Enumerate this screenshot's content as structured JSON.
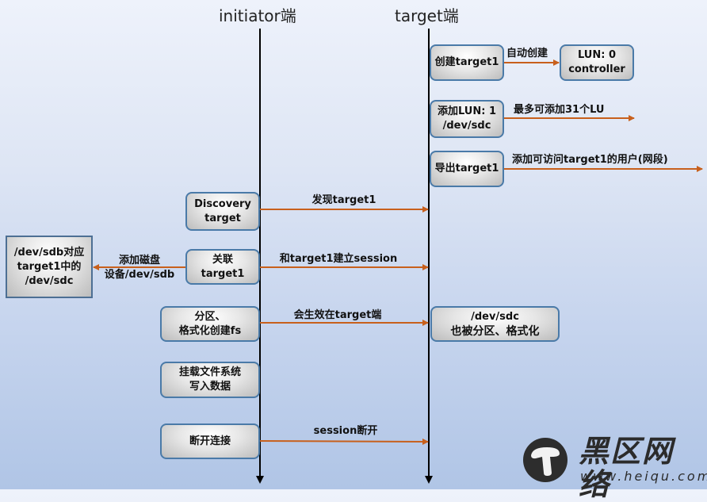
{
  "lanes": {
    "initiator": "initiator端",
    "target": "target端"
  },
  "colors": {
    "arrow": "#c8601c",
    "lifeline": "#000000",
    "box_border": "#4a7aa8"
  },
  "target_steps": [
    {
      "label_lines": [
        "创建target1"
      ],
      "arrow_label": "自动创建",
      "result_lines": [
        "LUN: 0",
        "controller"
      ]
    },
    {
      "label_lines": [
        "添加LUN: 1",
        "/dev/sdc"
      ],
      "arrow_label": "最多可添加31个LU"
    },
    {
      "label_lines": [
        "导出target1"
      ],
      "arrow_label": "添加可访问target1的用户(网段)"
    }
  ],
  "initiator_steps": [
    {
      "label_lines": [
        "Discovery",
        "target"
      ],
      "message": "发现target1"
    },
    {
      "label_lines": [
        "关联",
        "target1"
      ],
      "message": "和target1建立session",
      "side_label_lines": [
        "添加磁盘",
        "设备/dev/sdb"
      ],
      "side_box_lines": [
        "/dev/sdb对应",
        "target1中的",
        "/dev/sdc"
      ]
    },
    {
      "label_lines": [
        "分区、",
        "格式化创建fs"
      ],
      "message": "会生效在target端",
      "target_box_lines": [
        "/dev/sdc",
        "也被分区、格式化"
      ]
    },
    {
      "label_lines": [
        "挂载文件系统",
        "写入数据"
      ]
    },
    {
      "label_lines": [
        "断开连接"
      ],
      "message": "session断开"
    }
  ],
  "watermark": {
    "icon": "mushroom-icon",
    "name": "黑区网络",
    "url": "www.heiqu.com"
  }
}
